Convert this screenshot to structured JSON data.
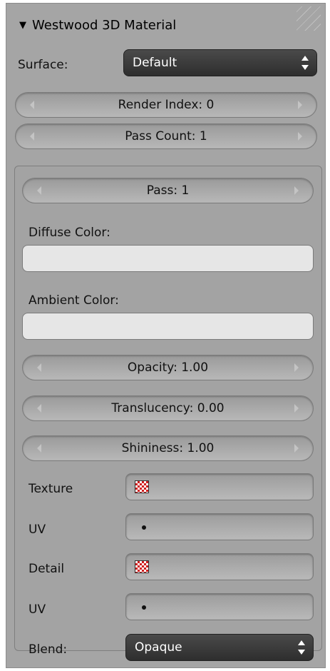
{
  "panel": {
    "title": "Westwood 3D Material",
    "collapse_icon": "triangle-down-icon",
    "surface_label": "Surface:",
    "surface_value": "Default",
    "render_index": "Render Index: 0",
    "pass_count": "Pass Count: 1"
  },
  "pass": {
    "pass_value": "Pass: 1",
    "diffuse_label": "Diffuse Color:",
    "diffuse_color": "#e6e6e6",
    "ambient_label": "Ambient Color:",
    "ambient_color": "#e6e6e6",
    "opacity": "Opacity: 1.00",
    "translucency": "Translucency: 0.00",
    "shininess": "Shininess: 1.00",
    "texture_label": "Texture",
    "uv1_label": "UV",
    "detail_label": "Detail",
    "uv2_label": "UV",
    "blend_label": "Blend:",
    "blend_value": "Opaque"
  },
  "icons": {
    "texture": "checker-texture-icon",
    "uv": "uv-dot-icon",
    "dropdown": "up-down-arrows-icon",
    "decrement": "left-arrow-icon",
    "increment": "right-arrow-icon"
  }
}
